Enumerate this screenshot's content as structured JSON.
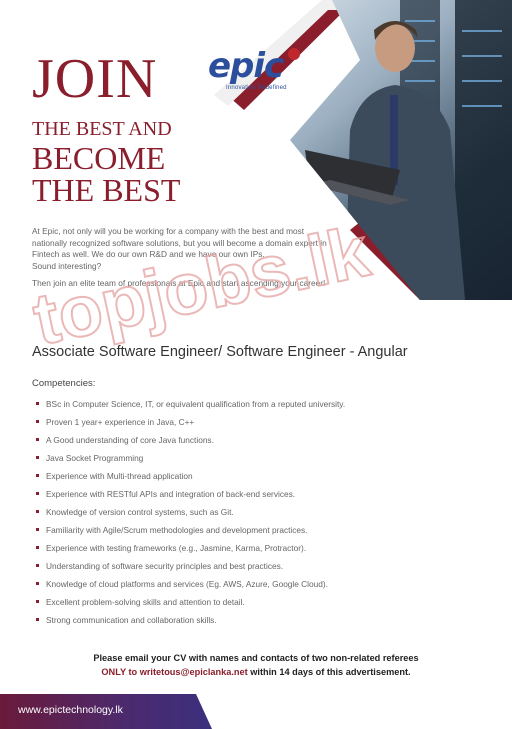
{
  "brand": {
    "name": "epic",
    "tagline": "Innovation Redefined",
    "colors": {
      "maroon": "#8a1e2c",
      "blue": "#2b4f9c",
      "purple": "#3b2f7e"
    }
  },
  "hero": {
    "join": "JOIN",
    "line1": "THE BEST AND",
    "line2": "BECOME",
    "line3": "THE BEST"
  },
  "intro": {
    "p1": "At Epic, not only will you be working for a company with the best and most nationally recognized software solutions, but you will become a domain expert in Fintech as well. We do our own R&D and we have our own IPs.",
    "p1b": "Sound interesting?",
    "p2": "Then join an elite team of professionals at Epic and start ascending your career!"
  },
  "job_title": "Associate Software Engineer/ Software Engineer - Angular",
  "competencies": {
    "heading": "Competencies:",
    "items": [
      "BSc in Computer Science, IT, or equivalent qualification from a reputed university.",
      "Proven 1 year+ experience in Java, C++",
      "A Good understanding of core Java functions.",
      "Java Socket Programming",
      "Experience with Multi-thread application",
      "Experience with RESTful APIs and integration of back-end services.",
      "Knowledge of version control systems, such as Git.",
      "Familiarity with Agile/Scrum methodologies and development practices.",
      "Experience with testing frameworks (e.g., Jasmine, Karma, Protractor).",
      "Understanding of software security principles and best practices.",
      "Knowledge of cloud platforms and services (Eg. AWS, Azure, Google Cloud).",
      "Excellent problem-solving skills and attention to detail.",
      "Strong communication and collaboration skills."
    ]
  },
  "apply": {
    "line1": "Please email your CV with names and contacts of two non-related referees",
    "line2_prefix": "ONLY to writetous@epiclanka.net",
    "line2_suffix": " within 14 days of this advertisement."
  },
  "footer": {
    "url": "www.epictechnology.lk"
  },
  "watermark": {
    "text": "topjobs.lk"
  }
}
